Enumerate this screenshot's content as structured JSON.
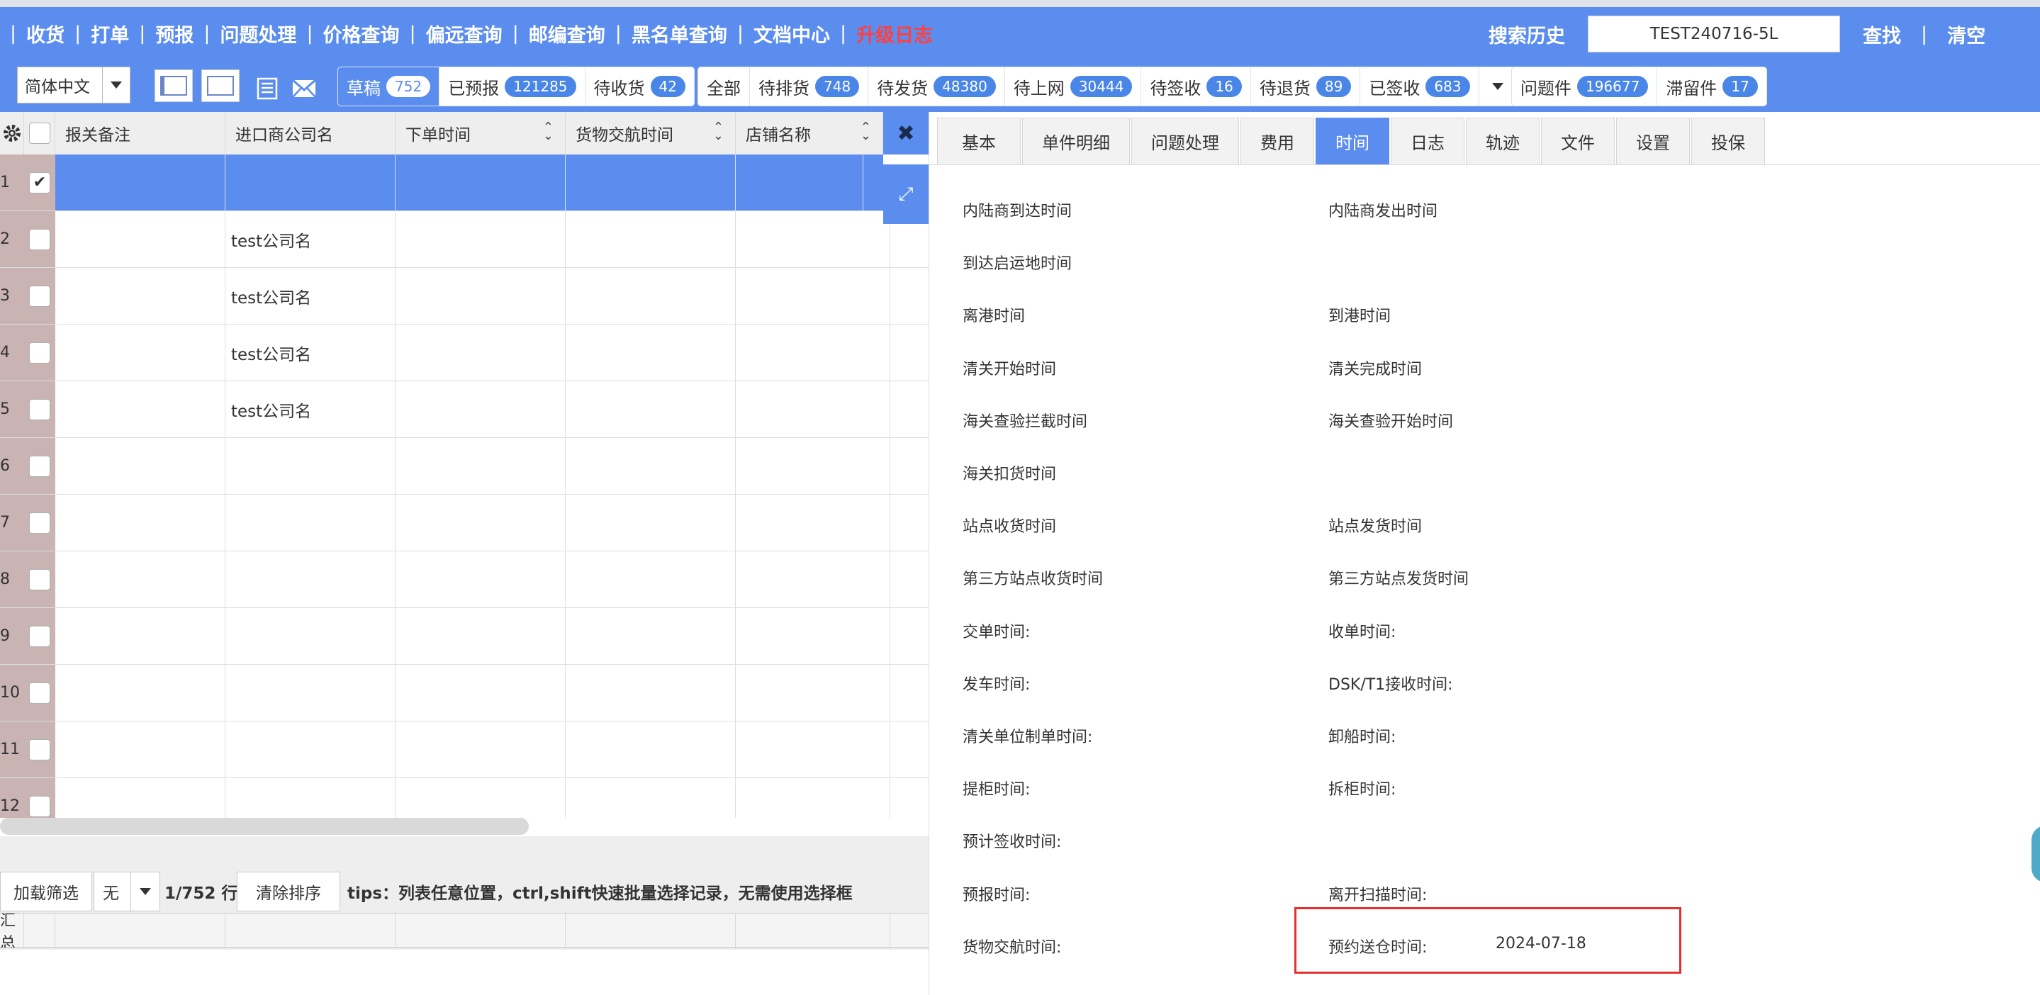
{
  "nav": {
    "items": [
      "收货",
      "打单",
      "预报",
      "问题处理",
      "价格查询",
      "偏远查询",
      "邮编查询",
      "黑名单查询",
      "文档中心"
    ],
    "upgrade": "升级日志",
    "sep": "|"
  },
  "search": {
    "history_label": "搜索历史",
    "value": "TEST240716-5L",
    "find_label": "查找",
    "sep": "|",
    "clear_label": "清空"
  },
  "toolbar": {
    "language": "简体中文",
    "group1": [
      {
        "label": "草稿",
        "count": "752",
        "active": true
      },
      {
        "label": "已预报",
        "count": "121285"
      },
      {
        "label": "待收货",
        "count": "42"
      }
    ],
    "group2": [
      {
        "label": "全部",
        "count": ""
      },
      {
        "label": "待排货",
        "count": "748"
      },
      {
        "label": "待发货",
        "count": "48380"
      },
      {
        "label": "待上网",
        "count": "30444"
      },
      {
        "label": "待签收",
        "count": "16"
      },
      {
        "label": "待退货",
        "count": "89"
      },
      {
        "label": "已签收",
        "count": "683"
      }
    ],
    "group3": [
      {
        "label": "问题件",
        "count": "196677"
      },
      {
        "label": "滞留件",
        "count": "17"
      }
    ]
  },
  "grid": {
    "columns": [
      "报关备注",
      "进口商公司名",
      "下单时间",
      "货物交航时间",
      "店铺名称"
    ],
    "rows": [
      {
        "no": "1",
        "checked": true,
        "company": ""
      },
      {
        "no": "2",
        "checked": false,
        "company": "test公司名"
      },
      {
        "no": "3",
        "checked": false,
        "company": "test公司名"
      },
      {
        "no": "4",
        "checked": false,
        "company": "test公司名"
      },
      {
        "no": "5",
        "checked": false,
        "company": "test公司名"
      },
      {
        "no": "6",
        "checked": false,
        "company": ""
      },
      {
        "no": "7",
        "checked": false,
        "company": ""
      },
      {
        "no": "8",
        "checked": false,
        "company": ""
      },
      {
        "no": "9",
        "checked": false,
        "company": ""
      },
      {
        "no": "10",
        "checked": false,
        "company": ""
      },
      {
        "no": "11",
        "checked": false,
        "company": ""
      },
      {
        "no": "12",
        "checked": false,
        "company": ""
      }
    ],
    "check_mark": "✔",
    "close_label": "✖",
    "expand_label": "⤢"
  },
  "footer": {
    "load_filter": "加载筛选",
    "filter_value": "无",
    "row_count": "1/752 行",
    "clear_sort": "清除排序",
    "tips": "tips：列表任意位置，ctrl,shift快速批量选择记录，无需使用选择框",
    "summary_label": "汇总"
  },
  "panel": {
    "tabs": [
      "基本",
      "单件明细",
      "问题处理",
      "费用",
      "时间",
      "日志",
      "轨迹",
      "文件",
      "设置",
      "投保"
    ],
    "active_tab": "时间",
    "fields": [
      {
        "left": "内陆商到达时间",
        "right": "内陆商发出时间"
      },
      {
        "left": "到达启运地时间",
        "right": ""
      },
      {
        "left": "离港时间",
        "right": "到港时间"
      },
      {
        "left": "清关开始时间",
        "right": "清关完成时间"
      },
      {
        "left": "海关查验拦截时间",
        "right": "海关查验开始时间"
      },
      {
        "left": "海关扣货时间",
        "right": ""
      },
      {
        "left": "站点收货时间",
        "right": "站点发货时间"
      },
      {
        "left": "第三方站点收货时间",
        "right": "第三方站点发货时间"
      },
      {
        "left": "交单时间:",
        "right": "收单时间:"
      },
      {
        "left": "发车时间:",
        "right": "DSK/T1接收时间:"
      },
      {
        "left": "清关单位制单时间:",
        "right": "卸船时间:"
      },
      {
        "left": "提柜时间:",
        "right": "拆柜时间:"
      },
      {
        "left": "预计签收时间:",
        "right": ""
      },
      {
        "left": "预报时间:",
        "right": "离开扫描时间:"
      },
      {
        "left": "货物交航时间:",
        "right": "预约送仓时间:"
      }
    ],
    "booking_date": "2024-07-18"
  },
  "colors": {
    "primary": "#5b8def",
    "badge": "#4a86e8",
    "upgrade": "#ff4040",
    "highlight": "#e53030",
    "rownum_bg": "#c9b3b3"
  },
  "icons": [
    "gear-icon",
    "list-view-icon",
    "card-view-icon",
    "document-list-icon",
    "mail-icon",
    "close-icon",
    "expand-icon",
    "sort-icon",
    "dropdown-caret-icon"
  ]
}
